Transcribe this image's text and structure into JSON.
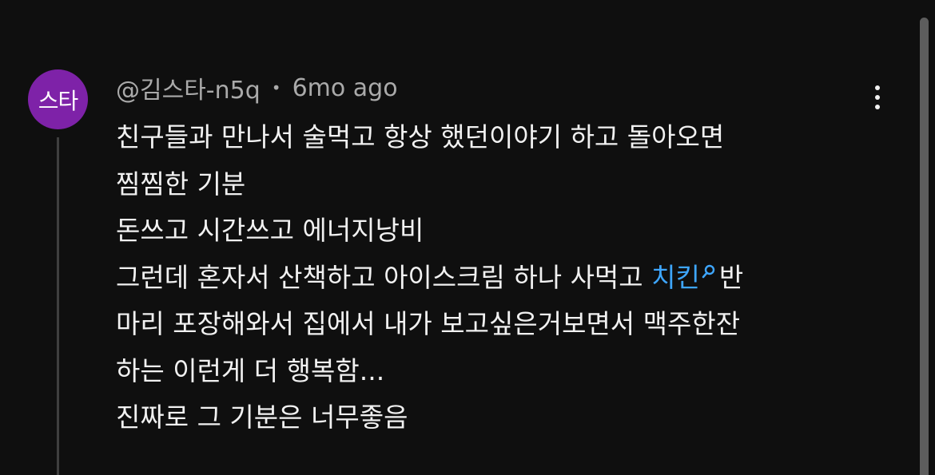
{
  "comment": {
    "avatar_text": "스타",
    "author": "@김스타-n5q",
    "separator": "•",
    "timestamp": "6mo ago",
    "lines": [
      "친구들과 만나서 술먹고 항상 했던이야기 하고 돌아오면",
      "찜찜한 기분",
      "돈쓰고 시간쓰고 에너지낭비"
    ],
    "line4_before": "그런데 혼자서 산책하고 아이스크림 하나 사먹고 ",
    "search_link": "치킨",
    "line4_after": "반",
    "lines_end": [
      "마리 포장해와서 집에서 내가 보고싶은거보면서 맥주한잔",
      "하는 이런게 더 행복함...",
      "진짜로 그 기분은 너무좋음"
    ]
  },
  "icons": {
    "more": "more-vert-icon",
    "search": "search-icon"
  },
  "colors": {
    "background": "#0f0f0f",
    "avatar": "#7e22a8",
    "link": "#3ea6ff",
    "meta_text": "#aaaaaa",
    "body_text": "#f1f1f1"
  }
}
